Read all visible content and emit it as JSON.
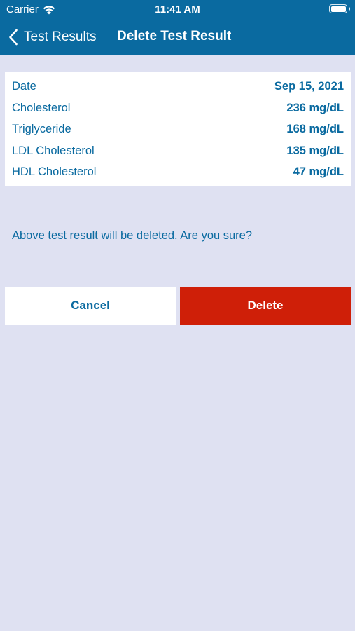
{
  "status_bar": {
    "carrier": "Carrier",
    "time": "11:41 AM"
  },
  "nav": {
    "back_label": "Test Results",
    "title": "Delete Test Result"
  },
  "result": {
    "rows": [
      {
        "label": "Date",
        "value": "Sep 15, 2021"
      },
      {
        "label": "Cholesterol",
        "value": "236 mg/dL"
      },
      {
        "label": "Triglyceride",
        "value": "168 mg/dL"
      },
      {
        "label": "LDL Cholesterol",
        "value": "135 mg/dL"
      },
      {
        "label": "HDL Cholesterol",
        "value": "47 mg/dL"
      }
    ]
  },
  "confirm_message": "Above test result will be deleted. Are you sure?",
  "actions": {
    "cancel_label": "Cancel",
    "delete_label": "Delete"
  },
  "colors": {
    "primary": "#0a6aa0",
    "danger": "#cf1f08",
    "background": "#dfe1f2"
  }
}
